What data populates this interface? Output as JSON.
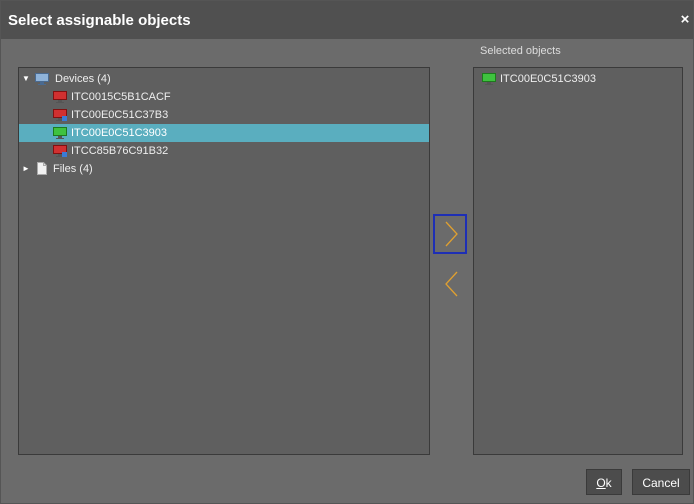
{
  "dialog": {
    "title": "Select assignable objects",
    "close_label": "×"
  },
  "tree": {
    "devices": {
      "label": "Devices (4)",
      "expanded": true,
      "icon": "monitor-group-icon",
      "items": [
        {
          "label": "ITC0015C5B1CACF",
          "icon": "monitor-red-icon",
          "selected": false
        },
        {
          "label": "ITC00E0C51C37B3",
          "icon": "monitor-red-alert-icon",
          "selected": false
        },
        {
          "label": "ITC00E0C51C3903",
          "icon": "monitor-green-icon",
          "selected": true
        },
        {
          "label": "ITCC85B76C91B32",
          "icon": "monitor-red-alert-icon",
          "selected": false
        }
      ]
    },
    "files": {
      "label": "Files (4)",
      "expanded": false,
      "icon": "file-icon"
    }
  },
  "selected": {
    "label": "Selected objects",
    "items": [
      {
        "label": "ITC00E0C51C3903",
        "icon": "monitor-green-icon"
      }
    ]
  },
  "buttons": {
    "ok_prefix": "O",
    "ok_rest": "k",
    "cancel": "Cancel"
  },
  "colors": {
    "dialog_bg": "#6b6b6b",
    "panel_bg": "#5f5f5f",
    "selection": "#5aaebf",
    "arrow": "#e0a030",
    "focus_border": "#1e2fb5"
  }
}
